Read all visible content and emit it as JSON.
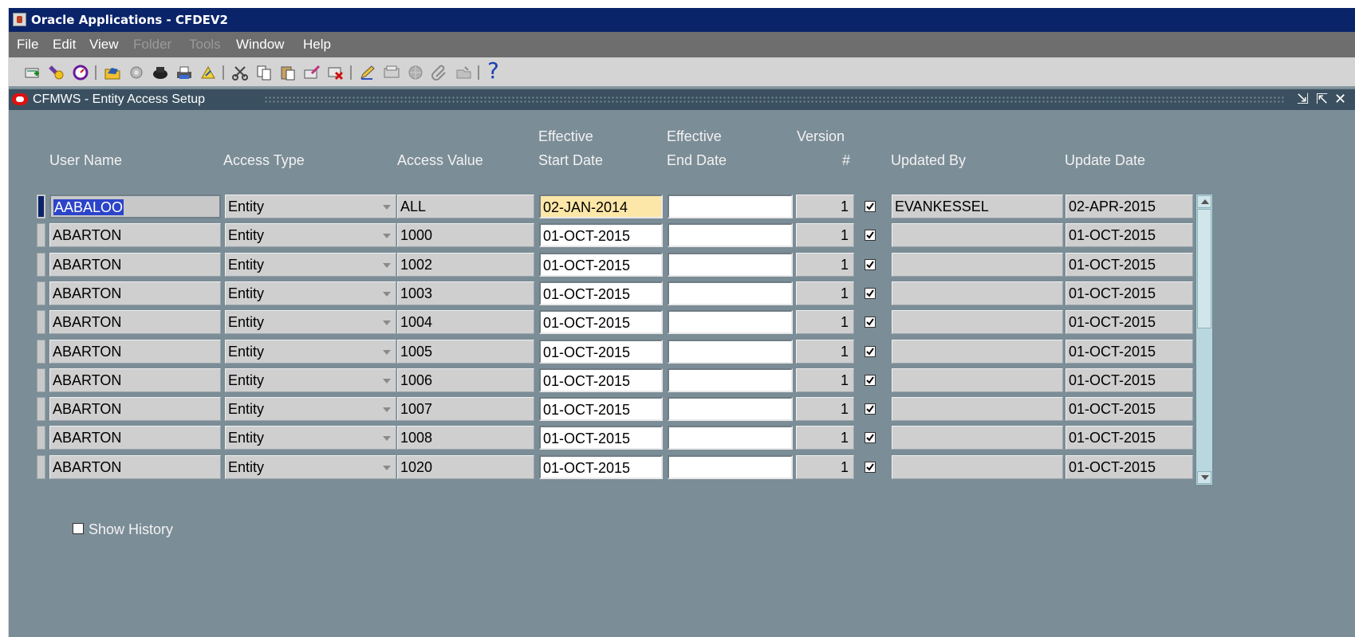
{
  "window": {
    "title": "Oracle Applications - CFDEV2"
  },
  "menu": [
    {
      "label": "File",
      "enabled": true
    },
    {
      "label": "Edit",
      "enabled": true
    },
    {
      "label": "View",
      "enabled": true
    },
    {
      "label": "Folder",
      "enabled": false
    },
    {
      "label": "Tools",
      "enabled": false
    },
    {
      "label": "Window",
      "enabled": true
    },
    {
      "label": "Help",
      "enabled": true
    }
  ],
  "toolbar": {
    "icons": [
      "new-record-icon",
      "find-icon",
      "navigator-icon",
      "open-folder-icon",
      "save-icon",
      "next-step-icon",
      "print-icon",
      "close-form-icon",
      "cut-icon",
      "copy-icon",
      "paste-icon",
      "new-row-icon",
      "delete-row-icon",
      "edit-field-icon",
      "zoom-icon",
      "translations-icon",
      "attachments-icon",
      "folder-tools-icon",
      "help-icon"
    ],
    "help_label": "?"
  },
  "form": {
    "title": "CFMWS - Entity Access Setup"
  },
  "columns": {
    "user_name": "User Name",
    "access_type": "Access Type",
    "access_value": "Access Value",
    "eff_start_1": "Effective",
    "eff_start_2": "Start Date",
    "eff_end_1": "Effective",
    "eff_end_2": "End Date",
    "version_1": "Version",
    "version_2": "#",
    "updated_by": "Updated By",
    "update_date": "Update Date"
  },
  "rows": [
    {
      "user_name": "AABALOO",
      "access_type": "Entity",
      "access_value": "ALL",
      "start_date": "02-JAN-2014",
      "end_date": "",
      "version": "1",
      "checked": true,
      "updated_by": "EVANKESSEL",
      "update_date": "02-APR-2015"
    },
    {
      "user_name": "ABARTON",
      "access_type": "Entity",
      "access_value": "1000",
      "start_date": "01-OCT-2015",
      "end_date": "",
      "version": "1",
      "checked": true,
      "updated_by": "",
      "update_date": "01-OCT-2015"
    },
    {
      "user_name": "ABARTON",
      "access_type": "Entity",
      "access_value": "1002",
      "start_date": "01-OCT-2015",
      "end_date": "",
      "version": "1",
      "checked": true,
      "updated_by": "",
      "update_date": "01-OCT-2015"
    },
    {
      "user_name": "ABARTON",
      "access_type": "Entity",
      "access_value": "1003",
      "start_date": "01-OCT-2015",
      "end_date": "",
      "version": "1",
      "checked": true,
      "updated_by": "",
      "update_date": "01-OCT-2015"
    },
    {
      "user_name": "ABARTON",
      "access_type": "Entity",
      "access_value": "1004",
      "start_date": "01-OCT-2015",
      "end_date": "",
      "version": "1",
      "checked": true,
      "updated_by": "",
      "update_date": "01-OCT-2015"
    },
    {
      "user_name": "ABARTON",
      "access_type": "Entity",
      "access_value": "1005",
      "start_date": "01-OCT-2015",
      "end_date": "",
      "version": "1",
      "checked": true,
      "updated_by": "",
      "update_date": "01-OCT-2015"
    },
    {
      "user_name": "ABARTON",
      "access_type": "Entity",
      "access_value": "1006",
      "start_date": "01-OCT-2015",
      "end_date": "",
      "version": "1",
      "checked": true,
      "updated_by": "",
      "update_date": "01-OCT-2015"
    },
    {
      "user_name": "ABARTON",
      "access_type": "Entity",
      "access_value": "1007",
      "start_date": "01-OCT-2015",
      "end_date": "",
      "version": "1",
      "checked": true,
      "updated_by": "",
      "update_date": "01-OCT-2015"
    },
    {
      "user_name": "ABARTON",
      "access_type": "Entity",
      "access_value": "1008",
      "start_date": "01-OCT-2015",
      "end_date": "",
      "version": "1",
      "checked": true,
      "updated_by": "",
      "update_date": "01-OCT-2015"
    },
    {
      "user_name": "ABARTON",
      "access_type": "Entity",
      "access_value": "1020",
      "start_date": "01-OCT-2015",
      "end_date": "",
      "version": "1",
      "checked": true,
      "updated_by": "",
      "update_date": "01-OCT-2015"
    }
  ],
  "show_history": {
    "label": "Show History",
    "checked": false
  }
}
